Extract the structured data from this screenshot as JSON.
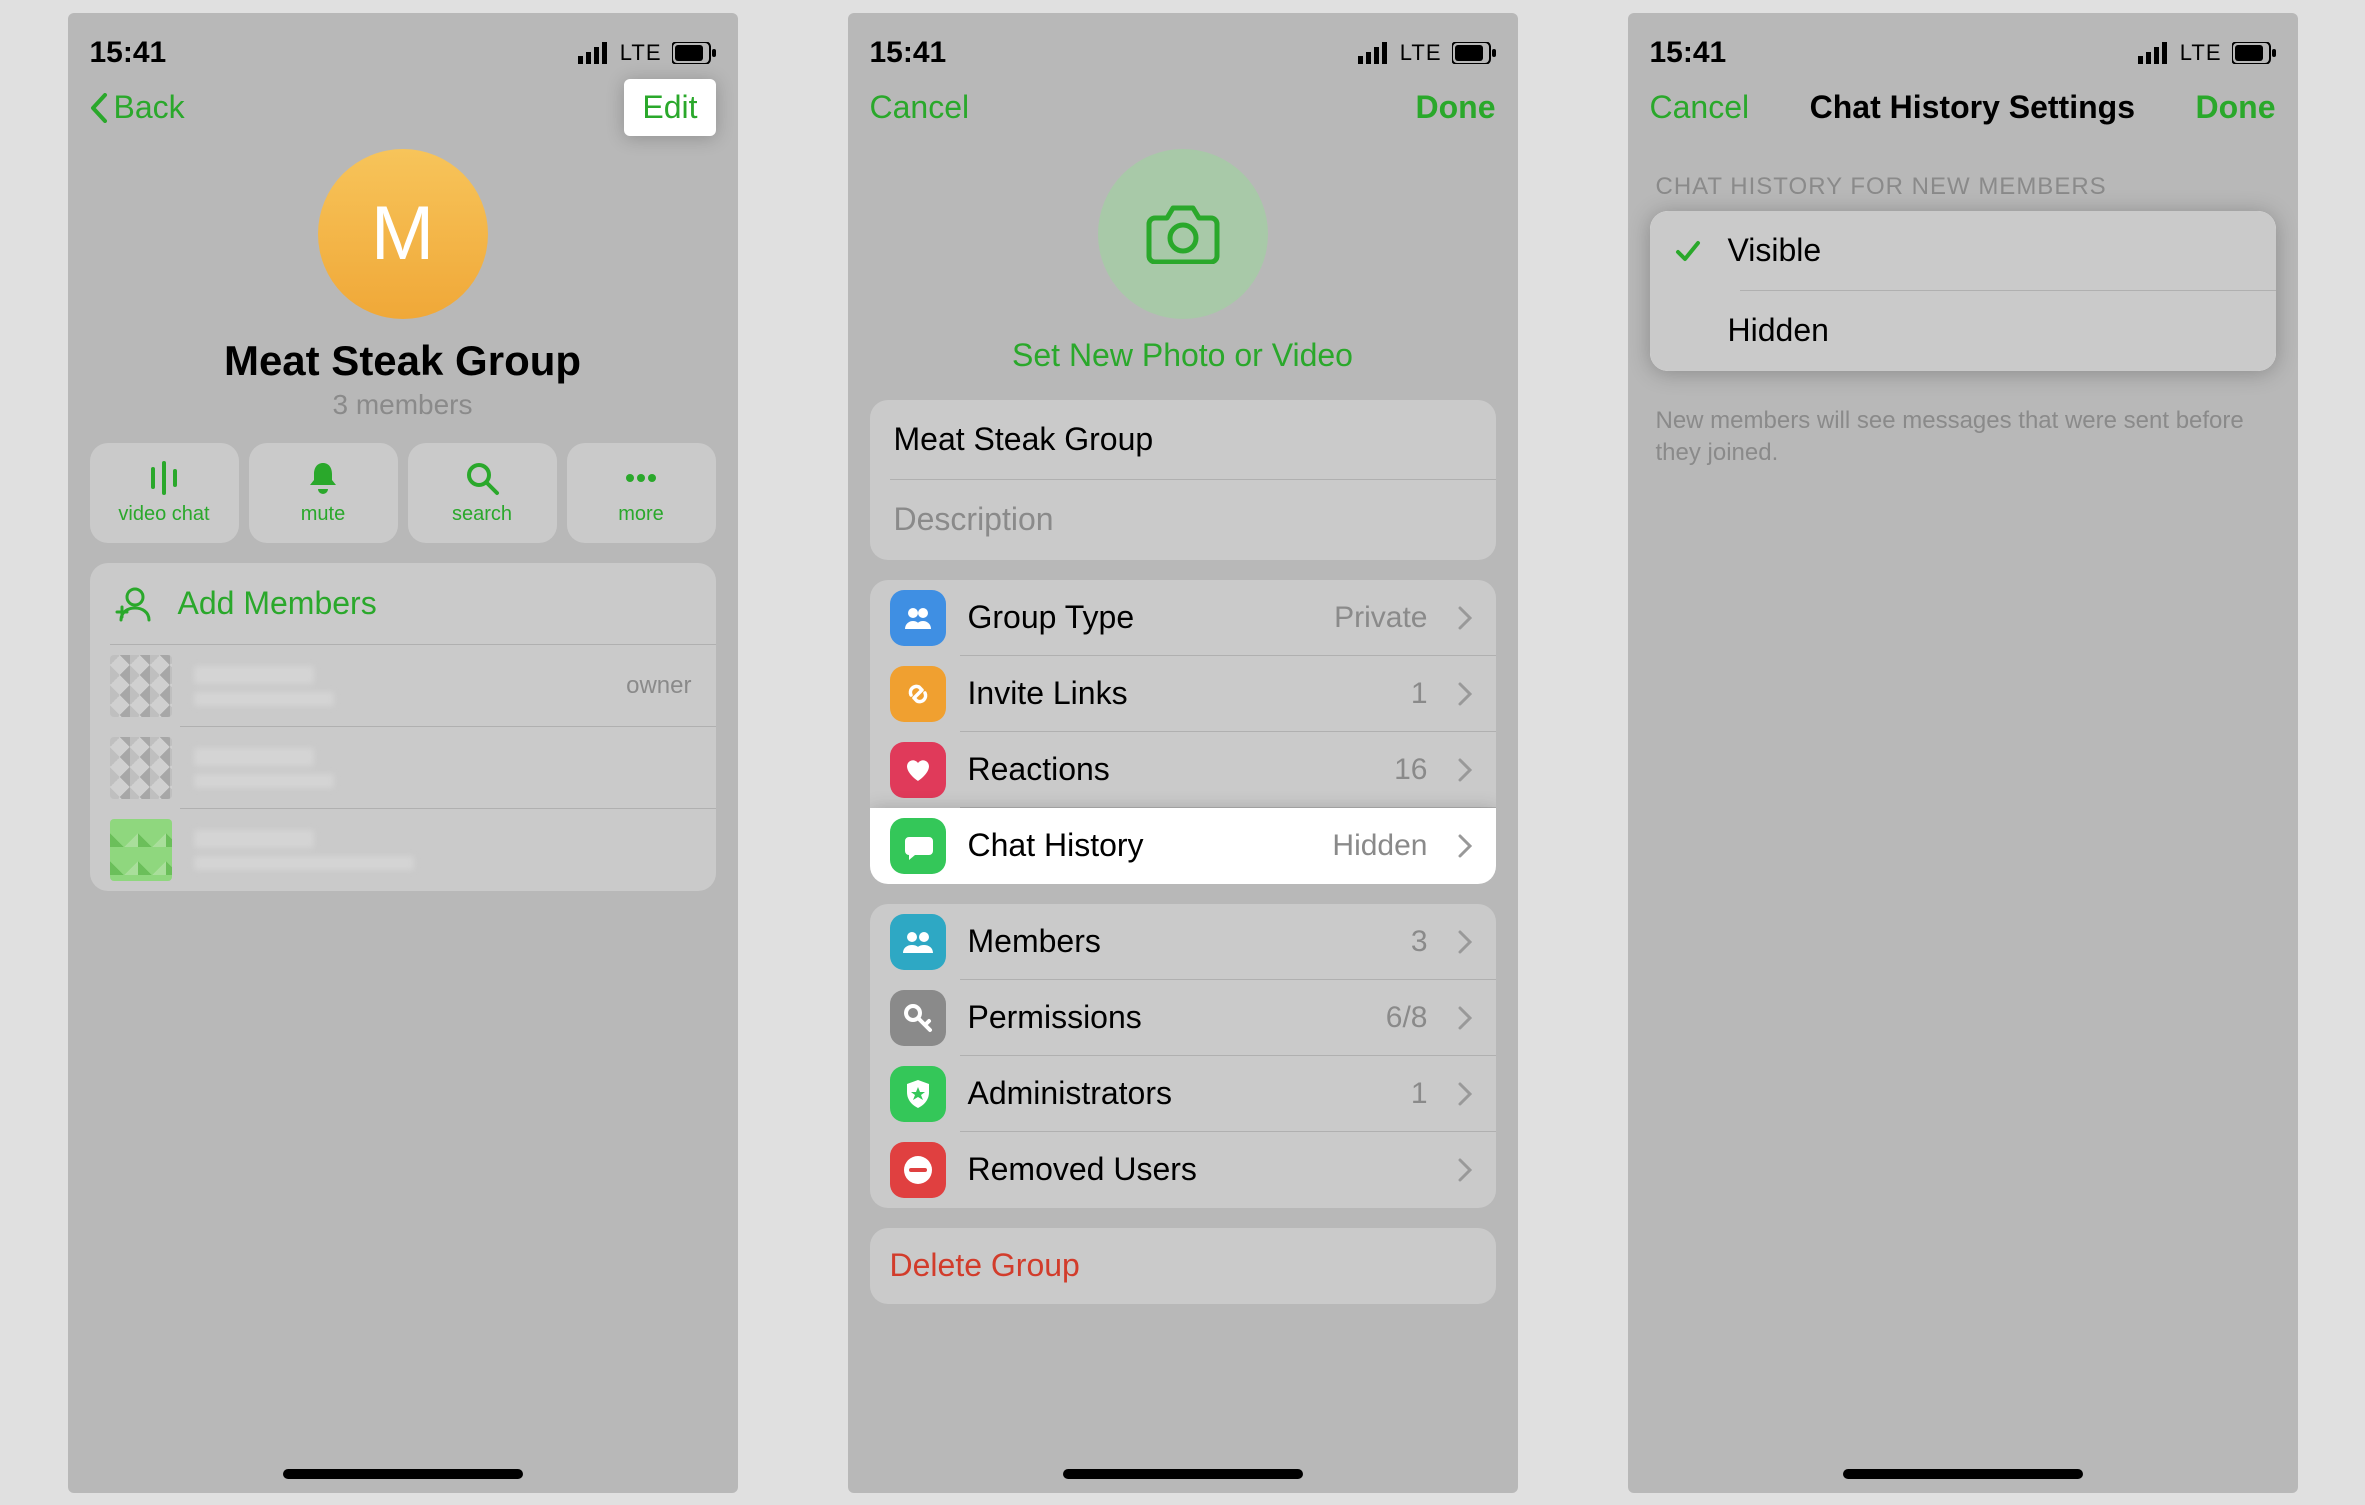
{
  "status": {
    "time": "15:41",
    "net": "LTE"
  },
  "screen1": {
    "back": "Back",
    "edit": "Edit",
    "avatar_letter": "M",
    "title": "Meat Steak Group",
    "subtitle": "3 members",
    "actions": {
      "video": "video chat",
      "mute": "mute",
      "search": "search",
      "more": "more"
    },
    "add_members": "Add Members",
    "owner": "owner"
  },
  "screen2": {
    "cancel": "Cancel",
    "done": "Done",
    "set_photo": "Set New Photo or Video",
    "name": "Meat Steak Group",
    "desc_ph": "Description",
    "group_type": {
      "label": "Group Type",
      "value": "Private"
    },
    "invite": {
      "label": "Invite Links",
      "value": "1"
    },
    "reactions": {
      "label": "Reactions",
      "value": "16"
    },
    "history": {
      "label": "Chat History",
      "value": "Hidden"
    },
    "members": {
      "label": "Members",
      "value": "3"
    },
    "permissions": {
      "label": "Permissions",
      "value": "6/8"
    },
    "admins": {
      "label": "Administrators",
      "value": "1"
    },
    "removed": {
      "label": "Removed Users",
      "value": ""
    },
    "delete": "Delete Group"
  },
  "screen3": {
    "cancel": "Cancel",
    "title": "Chat History Settings",
    "done": "Done",
    "section": "CHAT HISTORY FOR NEW MEMBERS",
    "visible": "Visible",
    "hidden": "Hidden",
    "footer": "New members will see messages that were sent before they joined."
  }
}
